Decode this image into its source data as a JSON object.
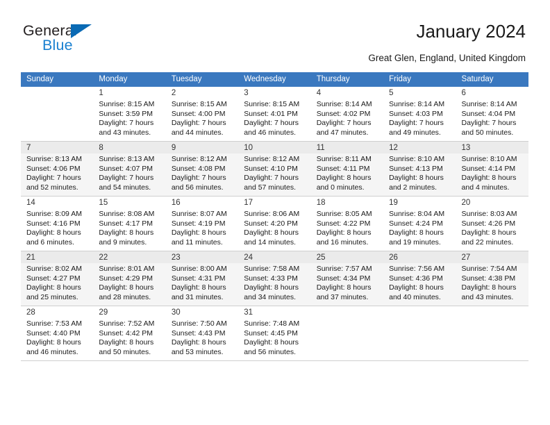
{
  "brand": {
    "name_part1": "General",
    "name_part2": "Blue",
    "triangle_color": "#0a6ab4",
    "blue_color": "#1a80d0"
  },
  "header": {
    "title": "January 2024",
    "subtitle": "Great Glen, England, United Kingdom",
    "header_bg": "#3a78bf",
    "header_text_color": "#ffffff"
  },
  "weekdays": [
    "Sunday",
    "Monday",
    "Tuesday",
    "Wednesday",
    "Thursday",
    "Friday",
    "Saturday"
  ],
  "weeks": [
    {
      "alt": false,
      "days": [
        {
          "num": "",
          "sunrise": "",
          "sunset": "",
          "daylight1": "",
          "daylight2": ""
        },
        {
          "num": "1",
          "sunrise": "Sunrise: 8:15 AM",
          "sunset": "Sunset: 3:59 PM",
          "daylight1": "Daylight: 7 hours",
          "daylight2": "and 43 minutes."
        },
        {
          "num": "2",
          "sunrise": "Sunrise: 8:15 AM",
          "sunset": "Sunset: 4:00 PM",
          "daylight1": "Daylight: 7 hours",
          "daylight2": "and 44 minutes."
        },
        {
          "num": "3",
          "sunrise": "Sunrise: 8:15 AM",
          "sunset": "Sunset: 4:01 PM",
          "daylight1": "Daylight: 7 hours",
          "daylight2": "and 46 minutes."
        },
        {
          "num": "4",
          "sunrise": "Sunrise: 8:14 AM",
          "sunset": "Sunset: 4:02 PM",
          "daylight1": "Daylight: 7 hours",
          "daylight2": "and 47 minutes."
        },
        {
          "num": "5",
          "sunrise": "Sunrise: 8:14 AM",
          "sunset": "Sunset: 4:03 PM",
          "daylight1": "Daylight: 7 hours",
          "daylight2": "and 49 minutes."
        },
        {
          "num": "6",
          "sunrise": "Sunrise: 8:14 AM",
          "sunset": "Sunset: 4:04 PM",
          "daylight1": "Daylight: 7 hours",
          "daylight2": "and 50 minutes."
        }
      ]
    },
    {
      "alt": true,
      "days": [
        {
          "num": "7",
          "sunrise": "Sunrise: 8:13 AM",
          "sunset": "Sunset: 4:06 PM",
          "daylight1": "Daylight: 7 hours",
          "daylight2": "and 52 minutes."
        },
        {
          "num": "8",
          "sunrise": "Sunrise: 8:13 AM",
          "sunset": "Sunset: 4:07 PM",
          "daylight1": "Daylight: 7 hours",
          "daylight2": "and 54 minutes."
        },
        {
          "num": "9",
          "sunrise": "Sunrise: 8:12 AM",
          "sunset": "Sunset: 4:08 PM",
          "daylight1": "Daylight: 7 hours",
          "daylight2": "and 56 minutes."
        },
        {
          "num": "10",
          "sunrise": "Sunrise: 8:12 AM",
          "sunset": "Sunset: 4:10 PM",
          "daylight1": "Daylight: 7 hours",
          "daylight2": "and 57 minutes."
        },
        {
          "num": "11",
          "sunrise": "Sunrise: 8:11 AM",
          "sunset": "Sunset: 4:11 PM",
          "daylight1": "Daylight: 8 hours",
          "daylight2": "and 0 minutes."
        },
        {
          "num": "12",
          "sunrise": "Sunrise: 8:10 AM",
          "sunset": "Sunset: 4:13 PM",
          "daylight1": "Daylight: 8 hours",
          "daylight2": "and 2 minutes."
        },
        {
          "num": "13",
          "sunrise": "Sunrise: 8:10 AM",
          "sunset": "Sunset: 4:14 PM",
          "daylight1": "Daylight: 8 hours",
          "daylight2": "and 4 minutes."
        }
      ]
    },
    {
      "alt": false,
      "days": [
        {
          "num": "14",
          "sunrise": "Sunrise: 8:09 AM",
          "sunset": "Sunset: 4:16 PM",
          "daylight1": "Daylight: 8 hours",
          "daylight2": "and 6 minutes."
        },
        {
          "num": "15",
          "sunrise": "Sunrise: 8:08 AM",
          "sunset": "Sunset: 4:17 PM",
          "daylight1": "Daylight: 8 hours",
          "daylight2": "and 9 minutes."
        },
        {
          "num": "16",
          "sunrise": "Sunrise: 8:07 AM",
          "sunset": "Sunset: 4:19 PM",
          "daylight1": "Daylight: 8 hours",
          "daylight2": "and 11 minutes."
        },
        {
          "num": "17",
          "sunrise": "Sunrise: 8:06 AM",
          "sunset": "Sunset: 4:20 PM",
          "daylight1": "Daylight: 8 hours",
          "daylight2": "and 14 minutes."
        },
        {
          "num": "18",
          "sunrise": "Sunrise: 8:05 AM",
          "sunset": "Sunset: 4:22 PM",
          "daylight1": "Daylight: 8 hours",
          "daylight2": "and 16 minutes."
        },
        {
          "num": "19",
          "sunrise": "Sunrise: 8:04 AM",
          "sunset": "Sunset: 4:24 PM",
          "daylight1": "Daylight: 8 hours",
          "daylight2": "and 19 minutes."
        },
        {
          "num": "20",
          "sunrise": "Sunrise: 8:03 AM",
          "sunset": "Sunset: 4:26 PM",
          "daylight1": "Daylight: 8 hours",
          "daylight2": "and 22 minutes."
        }
      ]
    },
    {
      "alt": true,
      "days": [
        {
          "num": "21",
          "sunrise": "Sunrise: 8:02 AM",
          "sunset": "Sunset: 4:27 PM",
          "daylight1": "Daylight: 8 hours",
          "daylight2": "and 25 minutes."
        },
        {
          "num": "22",
          "sunrise": "Sunrise: 8:01 AM",
          "sunset": "Sunset: 4:29 PM",
          "daylight1": "Daylight: 8 hours",
          "daylight2": "and 28 minutes."
        },
        {
          "num": "23",
          "sunrise": "Sunrise: 8:00 AM",
          "sunset": "Sunset: 4:31 PM",
          "daylight1": "Daylight: 8 hours",
          "daylight2": "and 31 minutes."
        },
        {
          "num": "24",
          "sunrise": "Sunrise: 7:58 AM",
          "sunset": "Sunset: 4:33 PM",
          "daylight1": "Daylight: 8 hours",
          "daylight2": "and 34 minutes."
        },
        {
          "num": "25",
          "sunrise": "Sunrise: 7:57 AM",
          "sunset": "Sunset: 4:34 PM",
          "daylight1": "Daylight: 8 hours",
          "daylight2": "and 37 minutes."
        },
        {
          "num": "26",
          "sunrise": "Sunrise: 7:56 AM",
          "sunset": "Sunset: 4:36 PM",
          "daylight1": "Daylight: 8 hours",
          "daylight2": "and 40 minutes."
        },
        {
          "num": "27",
          "sunrise": "Sunrise: 7:54 AM",
          "sunset": "Sunset: 4:38 PM",
          "daylight1": "Daylight: 8 hours",
          "daylight2": "and 43 minutes."
        }
      ]
    },
    {
      "alt": false,
      "days": [
        {
          "num": "28",
          "sunrise": "Sunrise: 7:53 AM",
          "sunset": "Sunset: 4:40 PM",
          "daylight1": "Daylight: 8 hours",
          "daylight2": "and 46 minutes."
        },
        {
          "num": "29",
          "sunrise": "Sunrise: 7:52 AM",
          "sunset": "Sunset: 4:42 PM",
          "daylight1": "Daylight: 8 hours",
          "daylight2": "and 50 minutes."
        },
        {
          "num": "30",
          "sunrise": "Sunrise: 7:50 AM",
          "sunset": "Sunset: 4:43 PM",
          "daylight1": "Daylight: 8 hours",
          "daylight2": "and 53 minutes."
        },
        {
          "num": "31",
          "sunrise": "Sunrise: 7:48 AM",
          "sunset": "Sunset: 4:45 PM",
          "daylight1": "Daylight: 8 hours",
          "daylight2": "and 56 minutes."
        },
        {
          "num": "",
          "sunrise": "",
          "sunset": "",
          "daylight1": "",
          "daylight2": ""
        },
        {
          "num": "",
          "sunrise": "",
          "sunset": "",
          "daylight1": "",
          "daylight2": ""
        },
        {
          "num": "",
          "sunrise": "",
          "sunset": "",
          "daylight1": "",
          "daylight2": ""
        }
      ]
    }
  ]
}
